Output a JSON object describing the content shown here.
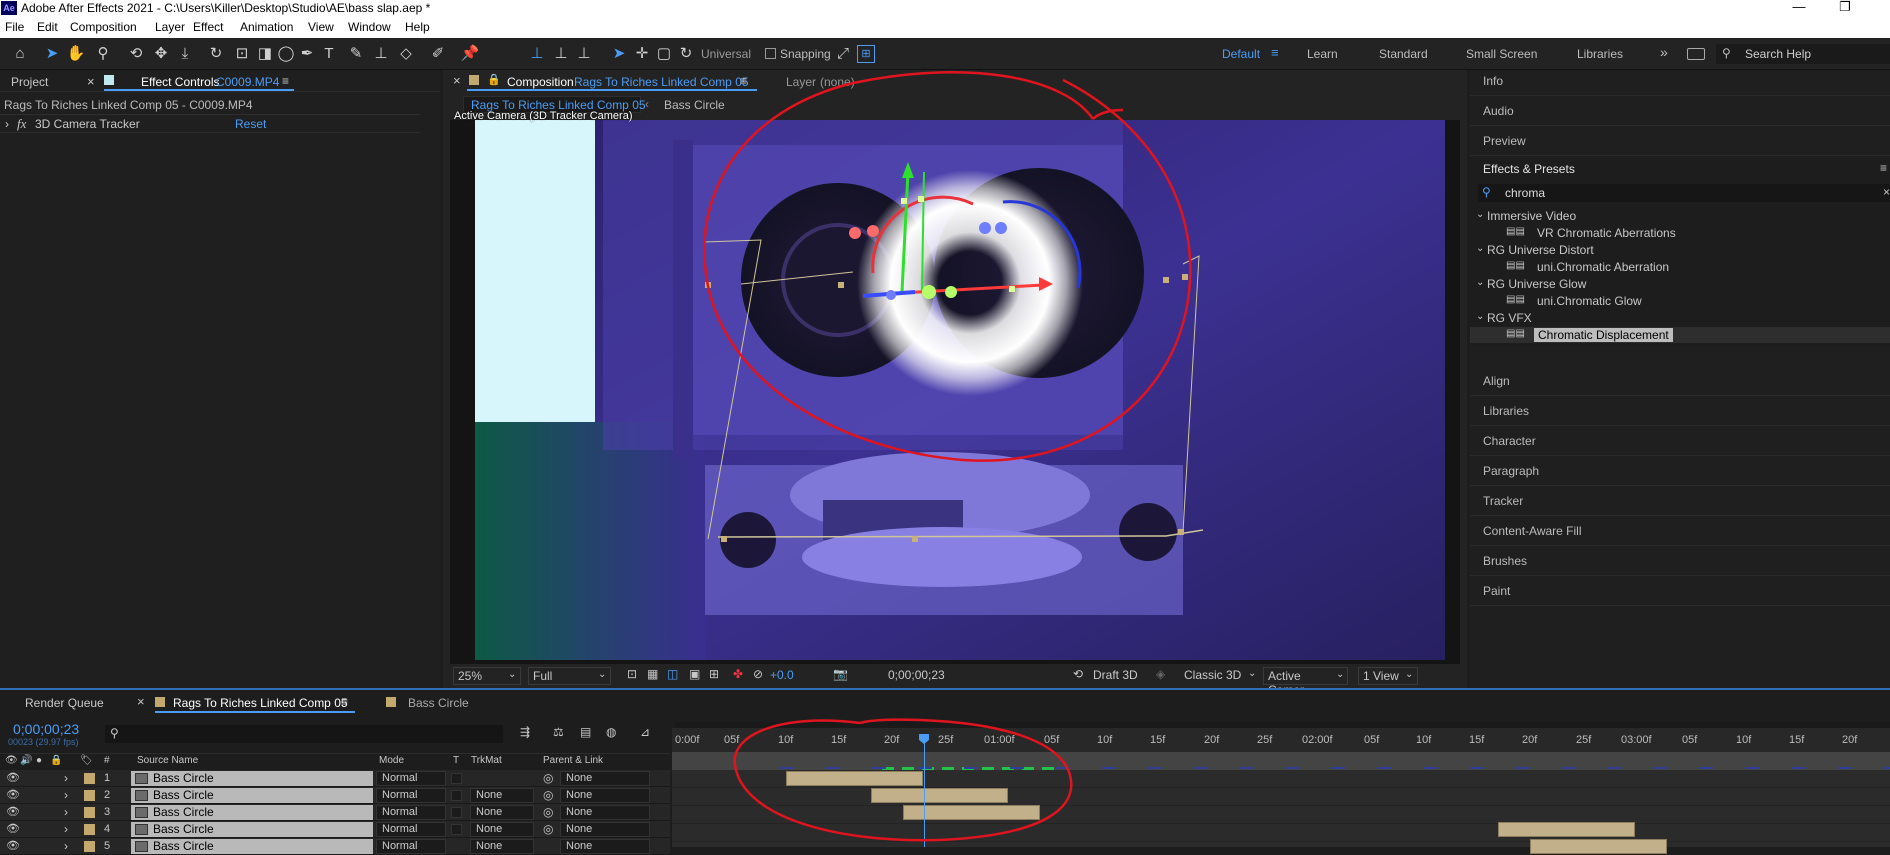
{
  "window": {
    "title": "Adobe After Effects 2021 - C:\\Users\\Killer\\Desktop\\Studio\\AE\\bass slap.aep *",
    "logo": "Ae"
  },
  "menu": [
    "File",
    "Edit",
    "Composition",
    "Layer",
    "Effect",
    "Animation",
    "View",
    "Window",
    "Help"
  ],
  "toolbar": {
    "universal_label": "Universal",
    "snapping_label": "Snapping",
    "workspaces": [
      "Default",
      "Learn",
      "Standard",
      "Small Screen",
      "Libraries"
    ],
    "search_placeholder": "Search Help"
  },
  "left_panel": {
    "project_tab": "Project",
    "effect_controls_tab": "Effect Controls",
    "effect_controls_file": "C0009.MP4",
    "header": "Rags To Riches Linked Comp 05 - C0009.MP4",
    "effect_name": "3D Camera Tracker",
    "reset_label": "Reset",
    "fx_label": "fx"
  },
  "comp_panel": {
    "composition_label": "Composition",
    "comp_name": "Rags To Riches Linked Comp 05",
    "layer_tab": "Layer",
    "layer_value": "(none)",
    "breadcrumb_active": "Rags To Riches Linked Comp 05",
    "breadcrumb_next": "Bass Circle",
    "viewer_label": "Active Camera (3D Tracker Camera)",
    "zoom": "25%",
    "resolution": "Full",
    "exposure": "+0.0",
    "timecode": "0;00;00;23",
    "renderer_draft": "Draft 3D",
    "renderer": "Classic 3D",
    "camera": "Active Camer...",
    "views": "1 View"
  },
  "right_panels": {
    "top": [
      "Info",
      "Audio",
      "Preview"
    ],
    "effects_presets": {
      "title": "Effects & Presets",
      "search_value": "chroma",
      "groups": [
        {
          "name": "Immersive Video",
          "items": [
            "VR Chromatic Aberrations"
          ]
        },
        {
          "name": "RG Universe Distort",
          "items": [
            "uni.Chromatic Aberration"
          ]
        },
        {
          "name": "RG Universe Glow",
          "items": [
            "uni.Chromatic Glow"
          ]
        },
        {
          "name": "RG VFX",
          "items": [
            "Chromatic Displacement"
          ]
        }
      ]
    },
    "bottom": [
      "Align",
      "Libraries",
      "Character",
      "Paragraph",
      "Tracker",
      "Content-Aware Fill",
      "Brushes",
      "Paint"
    ]
  },
  "timeline": {
    "tabs": [
      "Render Queue",
      "Rags To Riches Linked Comp 05",
      "Bass Circle"
    ],
    "timecode": "0;00;00;23",
    "frame_info": "00023 (29.97 fps)",
    "columns": {
      "number": "#",
      "source": "Source Name",
      "mode": "Mode",
      "t": "T",
      "trkmat": "TrkMat",
      "parent": "Parent & Link"
    },
    "ruler": [
      "0:00f",
      "05f",
      "10f",
      "15f",
      "20f",
      "25f",
      "01:00f",
      "05f",
      "10f",
      "15f",
      "20f",
      "25f",
      "02:00f",
      "05f",
      "10f",
      "15f",
      "20f",
      "25f",
      "03:00f",
      "05f",
      "10f",
      "15f",
      "20f"
    ],
    "layers": [
      {
        "num": "1",
        "name": "Bass Circle",
        "mode": "Normal",
        "trkmat": "",
        "parent": "None"
      },
      {
        "num": "2",
        "name": "Bass Circle",
        "mode": "Normal",
        "trkmat": "None",
        "parent": "None"
      },
      {
        "num": "3",
        "name": "Bass Circle",
        "mode": "Normal",
        "trkmat": "None",
        "parent": "None"
      },
      {
        "num": "4",
        "name": "Bass Circle",
        "mode": "Normal",
        "trkmat": "None",
        "parent": "None"
      },
      {
        "num": "5",
        "name": "Bass Circle",
        "mode": "Normal",
        "trkmat": "None",
        "parent": "None"
      }
    ]
  },
  "colors": {
    "accent": "#4b9cf5",
    "annotation": "#e0141e",
    "layer_label": "#c4a96f",
    "clip": "#c2b08b"
  }
}
